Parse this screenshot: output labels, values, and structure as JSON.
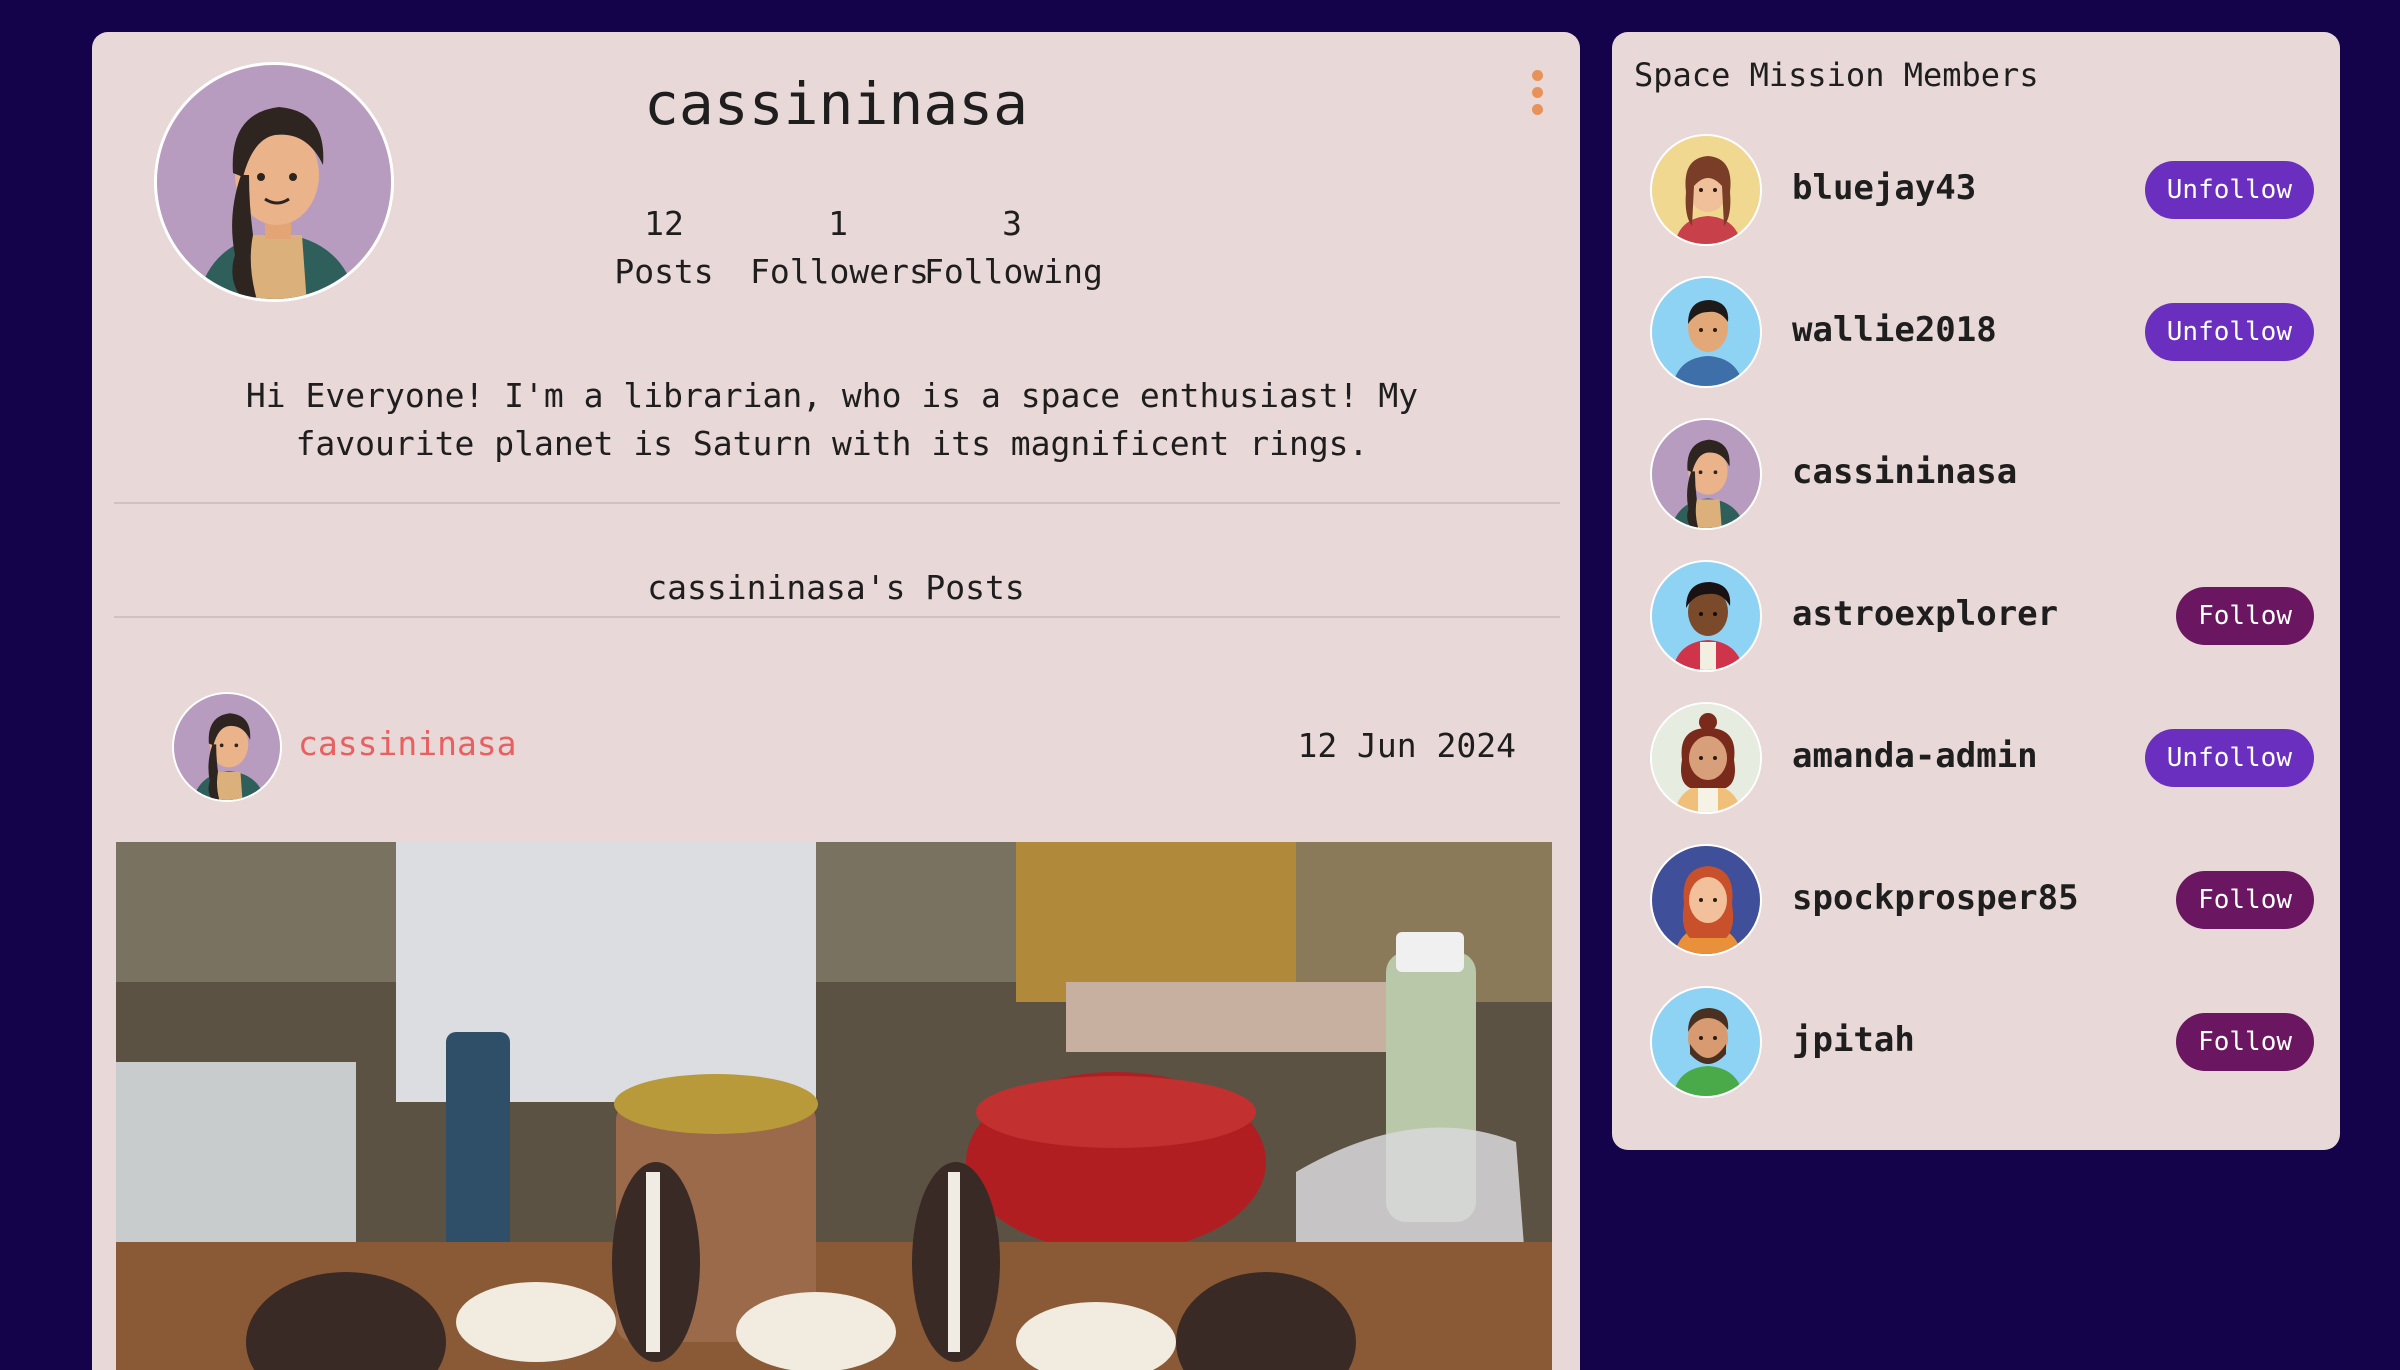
{
  "profile": {
    "username": "cassininasa",
    "stats": [
      {
        "count": "12",
        "label": "Posts"
      },
      {
        "count": "1",
        "label": "Followers"
      },
      {
        "count": "3",
        "label": "Following"
      }
    ],
    "bio_line1": "Hi Everyone! I'm a librarian, who is a space enthusiast! My",
    "bio_line2": "favourite planet is Saturn with its magnificent rings.",
    "avatar_icon": "woman-braid-avatar-icon",
    "menu_icon": "kebab-menu-icon"
  },
  "posts": {
    "heading": "cassininasa's Posts",
    "items": [
      {
        "author": "cassininasa",
        "date": "12 Jun 2024",
        "image": "photo of cookies-and-cream cupcakes on a cluttered table"
      }
    ]
  },
  "members": {
    "title": "Space Mission Members",
    "list": [
      {
        "name": "bluejay43",
        "button": "Unfollow",
        "avatar_bg": "#f0d890",
        "icon": "woman-red-top-avatar-icon"
      },
      {
        "name": "wallie2018",
        "button": "Unfollow",
        "avatar_bg": "#8fd3f4",
        "icon": "man-blue-shirt-avatar-icon"
      },
      {
        "name": "cassininasa",
        "button": "",
        "avatar_bg": "#b79cbf",
        "icon": "woman-braid-avatar-icon"
      },
      {
        "name": "astroexplorer",
        "button": "Follow",
        "avatar_bg": "#8fd3f4",
        "icon": "man-red-jacket-avatar-icon"
      },
      {
        "name": "amanda-admin",
        "button": "Unfollow",
        "avatar_bg": "#e6ece0",
        "icon": "woman-curly-hair-avatar-icon"
      },
      {
        "name": "spockprosper85",
        "button": "Follow",
        "avatar_bg": "#3f4f9a",
        "icon": "woman-orange-hair-avatar-icon"
      },
      {
        "name": "jpitah",
        "button": "Follow",
        "avatar_bg": "#8fd3f4",
        "icon": "man-beard-green-shirt-avatar-icon"
      }
    ]
  },
  "colors": {
    "page_bg": "#14034a",
    "card_bg": "#e8d8d8",
    "unfollow_btn": "#6a2fbf",
    "follow_btn": "#6a1660",
    "author_link": "#e86060",
    "menu_dots": "#e8925a"
  }
}
